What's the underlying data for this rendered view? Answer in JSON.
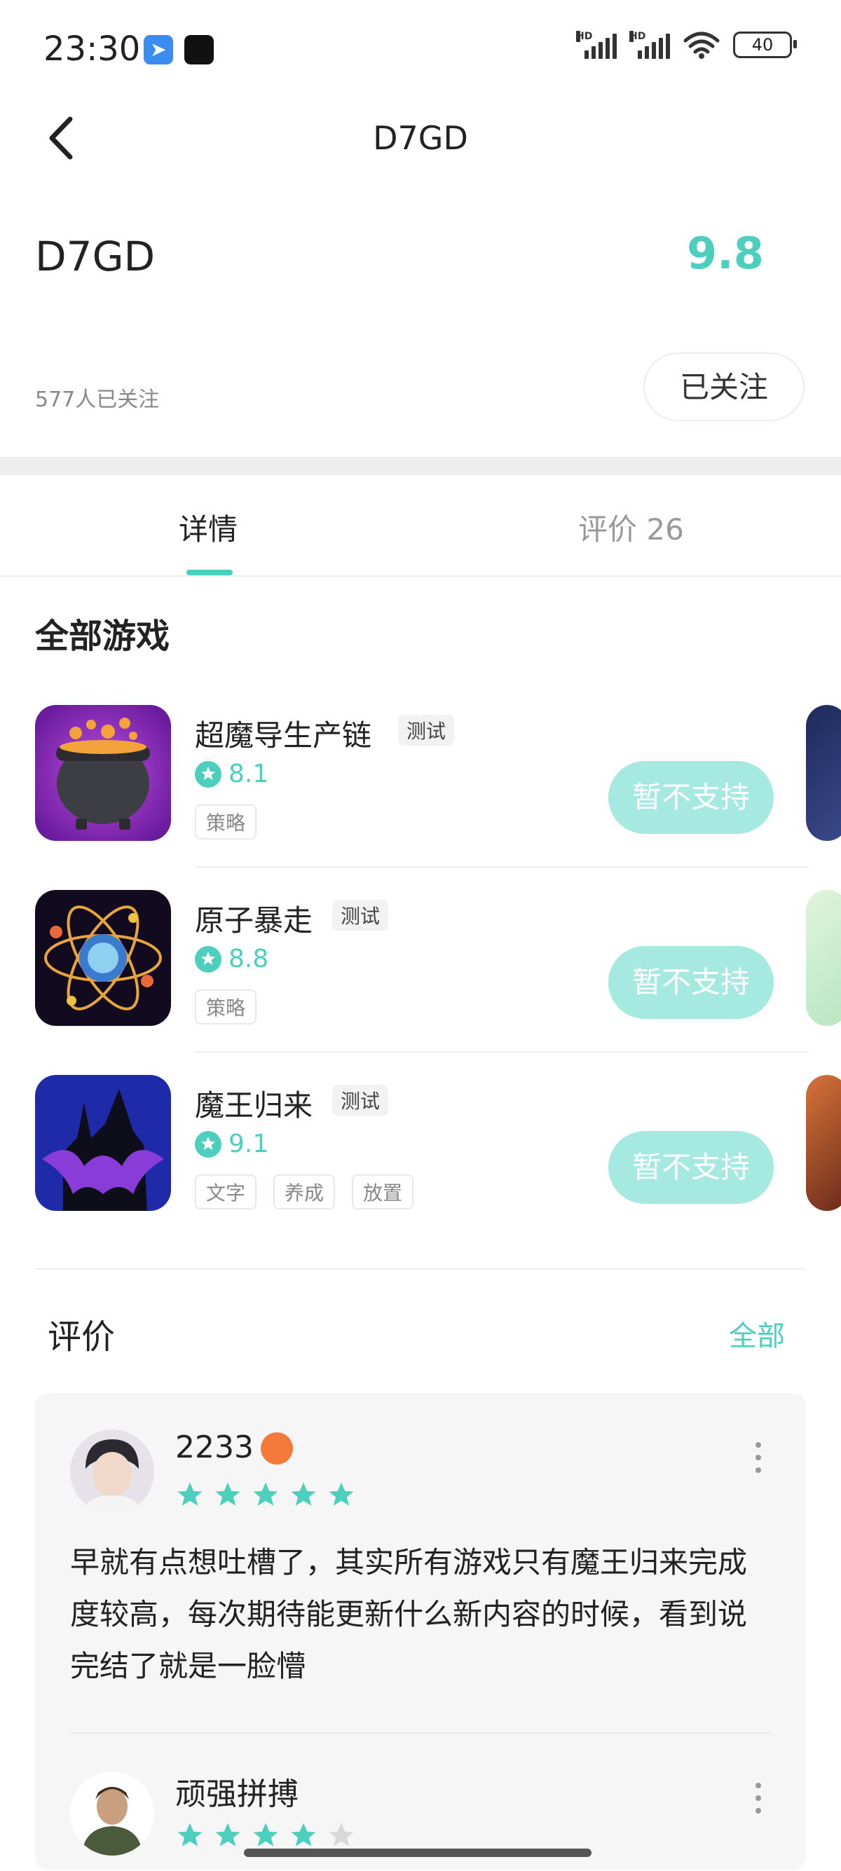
{
  "status_bar": {
    "time": "23:30",
    "battery": "40",
    "icons": [
      "app-notification-icon",
      "app-notification-icon",
      "signal-icon",
      "signal-icon",
      "wifi-icon",
      "battery-icon"
    ]
  },
  "header": {
    "title": "D7GD",
    "back_icon": "chevron-left-icon"
  },
  "developer": {
    "name": "D7GD",
    "score": "9.8",
    "followers": "577人已关注",
    "follow_button": "已关注"
  },
  "tabs": [
    {
      "label": "详情",
      "active": true
    },
    {
      "label": "评价",
      "count": "26",
      "active": false
    }
  ],
  "games_section": {
    "title": "全部游戏",
    "games": [
      {
        "name": "超魔导生产链",
        "badge": "测试",
        "rating": "8.1",
        "tags": [
          "策略"
        ],
        "button": "暂不支持",
        "icon": "cauldron-icon"
      },
      {
        "name": "原子暴走",
        "badge": "测试",
        "rating": "8.8",
        "tags": [
          "策略"
        ],
        "button": "暂不支持",
        "icon": "atom-icon"
      },
      {
        "name": "魔王归来",
        "badge": "测试",
        "rating": "9.1",
        "tags": [
          "文字",
          "养成",
          "放置"
        ],
        "button": "暂不支持",
        "icon": "castle-bat-icon"
      }
    ]
  },
  "reviews_section": {
    "title": "评价",
    "all_link": "全部",
    "reviews": [
      {
        "user": "2233",
        "stars": 5,
        "text": "早就有点想吐槽了，其实所有游戏只有魔王归来完成度较高，每次期待能更新什么新内容的时候，看到说完结了就是一脸懵"
      },
      {
        "user": "顽强拼搏",
        "stars": 4
      }
    ]
  },
  "colors": {
    "accent": "#4ccfbd",
    "unsupported_button": "#a5e9e0"
  }
}
